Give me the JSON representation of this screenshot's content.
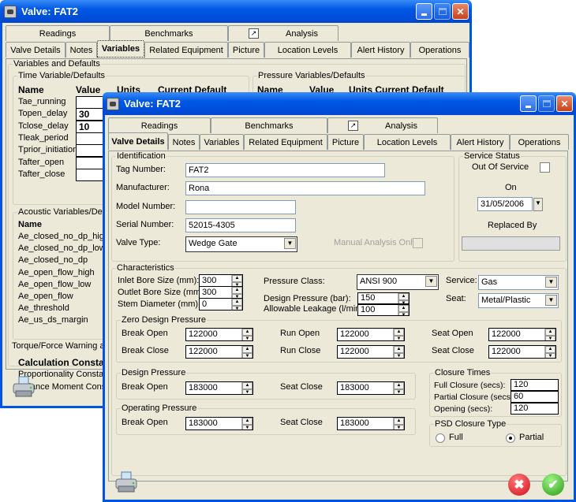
{
  "back_window": {
    "title": "Valve: FAT2",
    "tabs_row1": [
      "Readings",
      "Benchmarks",
      "Analysis"
    ],
    "tabs_row2": [
      "Valve Details",
      "Notes",
      "Variables",
      "Related Equipment",
      "Picture",
      "Location Levels",
      "Alert History",
      "Operations"
    ],
    "active_tab": "Variables",
    "section_title": "Variables and Defaults",
    "time_group": {
      "title": "Time Variable/Defaults",
      "headers": [
        "Name",
        "Value",
        "Units",
        "Current Default"
      ],
      "rows": [
        {
          "name": "Tae_running",
          "value": ""
        },
        {
          "name": "Topen_delay",
          "value": "30"
        },
        {
          "name": "Tclose_delay",
          "value": "10"
        },
        {
          "name": "Tleak_period",
          "value": ""
        },
        {
          "name": "Tprior_initiation",
          "value": ""
        },
        {
          "name": "Tafter_open",
          "value": ""
        },
        {
          "name": "Tafter_close",
          "value": ""
        }
      ]
    },
    "pressure_group": {
      "title": "Pressure Variables/Defaults",
      "headers": [
        "Name",
        "Value",
        "Units Current Default"
      ]
    },
    "acoustic_group": {
      "title": "Acoustic Variables/Defau",
      "header": "Name",
      "rows": [
        "Ae_closed_no_dp_high",
        "Ae_closed_no_dp_low",
        "Ae_closed_no_dp",
        "Ae_open_flow_high",
        "Ae_open_flow_low",
        "Ae_open_flow",
        "Ae_threshold",
        "Ae_us_ds_margin"
      ]
    },
    "torque_label": "Torque/Force Warning at",
    "calc_title": "Calculation Constants",
    "calc_rows": [
      "Proportionality Constant fo",
      "Balance Moment Constan"
    ]
  },
  "front_window": {
    "title": "Valve: FAT2",
    "tabs_row1": [
      "Readings",
      "Benchmarks",
      "Analysis"
    ],
    "tabs_row2": [
      "Valve Details",
      "Notes",
      "Variables",
      "Related Equipment",
      "Picture",
      "Location Levels",
      "Alert History",
      "Operations"
    ],
    "active_tab": "Valve Details",
    "identification": {
      "title": "Identification",
      "tag_label": "Tag Number:",
      "tag_value": "FAT2",
      "manufacturer_label": "Manufacturer:",
      "manufacturer_value": "Rona",
      "model_label": "Model Number:",
      "model_value": "",
      "serial_label": "Serial Number:",
      "serial_value": "52015-4305",
      "valve_type_label": "Valve Type:",
      "valve_type_value": "Wedge Gate",
      "manual_analysis_label": "Manual Analysis Only",
      "manual_analysis_checked": false
    },
    "service_status": {
      "title": "Service Status",
      "out_of_service_label": "Out Of Service",
      "out_of_service_checked": false,
      "on_label": "On",
      "on_date": "31/05/2006",
      "replaced_by_label": "Replaced By",
      "replaced_by_value": ""
    },
    "characteristics": {
      "title": "Characteristics",
      "inlet_label": "Inlet Bore Size (mm):",
      "inlet_value": "300",
      "outlet_label": "Outlet Bore Size (mm):",
      "outlet_value": "300",
      "stem_label": "Stem Diameter (mm):",
      "stem_value": "0",
      "pressure_class_label": "Pressure Class:",
      "pressure_class_value": "ANSI 900",
      "design_pressure_label": "Design Pressure (bar):",
      "design_pressure_value": "150",
      "leakage_label": "Allowable Leakage (l/min):",
      "leakage_value": "100",
      "service_label": "Service:",
      "service_value": "Gas",
      "seat_label": "Seat:",
      "seat_value": "Metal/Plastic"
    },
    "zero_design_pressure": {
      "title": "Zero Design Pressure",
      "fields": [
        {
          "label": "Break Open",
          "value": "122000"
        },
        {
          "label": "Run Open",
          "value": "122000"
        },
        {
          "label": "Seat Open",
          "value": "122000"
        },
        {
          "label": "Break Close",
          "value": "122000"
        },
        {
          "label": "Run Close",
          "value": "122000"
        },
        {
          "label": "Seat Close",
          "value": "122000"
        }
      ]
    },
    "design_pressure": {
      "title": "Design Pressure",
      "fields": [
        {
          "label": "Break Open",
          "value": "183000"
        },
        {
          "label": "Seat Close",
          "value": "183000"
        }
      ]
    },
    "operating_pressure": {
      "title": "Operating Pressure",
      "fields": [
        {
          "label": "Break Open",
          "value": "183000"
        },
        {
          "label": "Seat Close",
          "value": "183000"
        }
      ]
    },
    "closure_times": {
      "title": "Closure Times",
      "full_label": "Full Closure (secs):",
      "full_value": "120",
      "partial_label": "Partial Closure (secs):",
      "partial_value": "60",
      "opening_label": "Opening (secs):",
      "opening_value": "120"
    },
    "psd_closure_type": {
      "title": "PSD Closure Type",
      "options": [
        "Full",
        "Partial"
      ],
      "selected": "Partial"
    },
    "buttons": {
      "cancel_symbol": "✖",
      "ok_symbol": "✔"
    }
  }
}
